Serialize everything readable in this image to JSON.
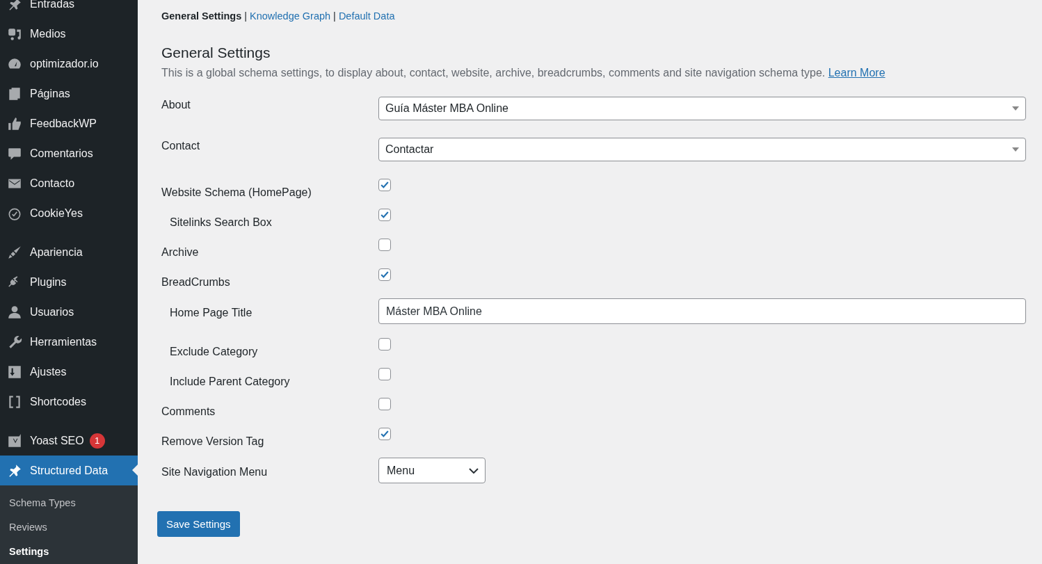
{
  "sidebar": {
    "groups": [
      [
        {
          "label": "Entradas",
          "selected": false
        },
        {
          "label": "Medios",
          "selected": false
        },
        {
          "label": "optimizador.io",
          "selected": false
        },
        {
          "label": "Páginas",
          "selected": false
        },
        {
          "label": "FeedbackWP",
          "selected": false
        },
        {
          "label": "Comentarios",
          "selected": false
        },
        {
          "label": "Contacto",
          "selected": false
        },
        {
          "label": "CookieYes",
          "selected": false
        }
      ],
      [
        {
          "label": "Apariencia",
          "selected": false
        },
        {
          "label": "Plugins",
          "selected": false
        },
        {
          "label": "Usuarios",
          "selected": false
        },
        {
          "label": "Herramientas",
          "selected": false
        },
        {
          "label": "Ajustes",
          "selected": false
        },
        {
          "label": "Shortcodes",
          "selected": false
        }
      ],
      [
        {
          "label": "Yoast SEO",
          "selected": false,
          "badge": "1"
        },
        {
          "label": "Structured Data",
          "selected": true
        }
      ]
    ],
    "submenu": [
      {
        "label": "Schema Types",
        "selected": false
      },
      {
        "label": "Reviews",
        "selected": false
      },
      {
        "label": "Settings",
        "selected": true
      }
    ]
  },
  "tabs": {
    "separator": "|",
    "items": [
      {
        "label": "General Settings",
        "selected": true
      },
      {
        "label": "Knowledge Graph",
        "selected": false
      },
      {
        "label": "Default Data",
        "selected": false
      }
    ]
  },
  "title": "General Settings",
  "description": {
    "text": "This is a global schema settings, to display about, contact, website, archive, breadcrumbs, comments and site navigation schema type.",
    "link": "Learn More"
  },
  "fields": [
    {
      "kind": "select",
      "label": "About",
      "value": "Guía Máster MBA Online"
    },
    {
      "kind": "select",
      "label": "Contact",
      "value": "Contactar"
    },
    {
      "kind": "checkbox",
      "label": "Website Schema (HomePage)",
      "checked": true,
      "children": [
        {
          "kind": "checkbox",
          "label": "Sitelinks Search Box",
          "checked": true
        }
      ]
    },
    {
      "kind": "checkbox",
      "label": "Archive",
      "checked": false
    },
    {
      "kind": "checkbox",
      "label": "BreadCrumbs",
      "checked": true,
      "children": [
        {
          "kind": "text",
          "label": "Home Page Title",
          "value": "Máster MBA Online"
        },
        {
          "kind": "checkbox",
          "label": "Exclude Category",
          "checked": false
        },
        {
          "kind": "checkbox",
          "label": "Include Parent Category",
          "checked": false
        }
      ]
    },
    {
      "kind": "checkbox",
      "label": "Comments",
      "checked": false
    },
    {
      "kind": "checkbox",
      "label": "Remove Version Tag",
      "checked": true
    },
    {
      "kind": "dropdown",
      "label": "Site Navigation Menu",
      "value": "Menu"
    }
  ],
  "save_button": "Save Settings"
}
